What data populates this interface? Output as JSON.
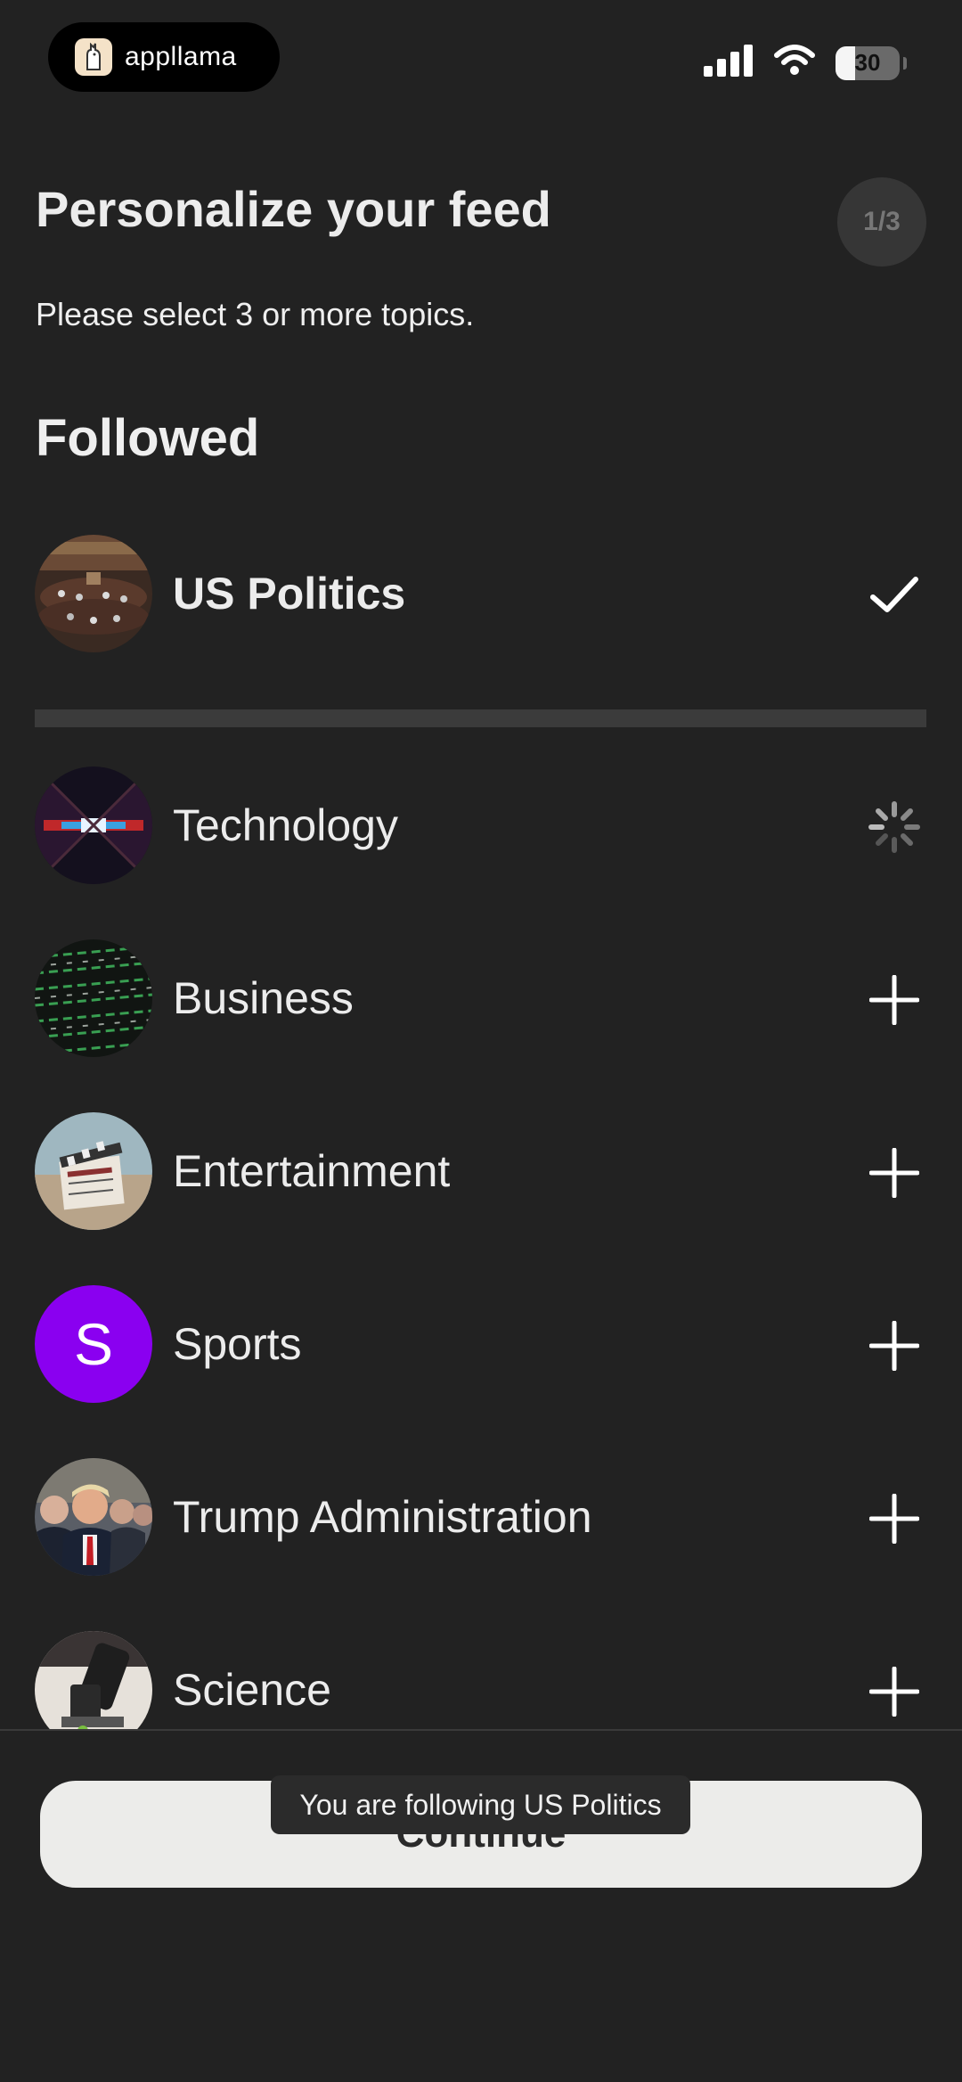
{
  "status_bar": {
    "app_name": "appllama",
    "battery": "30",
    "battery_level_percent": 30,
    "icons": [
      "cellular-signal-icon",
      "wifi-icon",
      "battery-icon"
    ]
  },
  "header": {
    "title": "Personalize your feed",
    "step": "1/3",
    "subtitle": "Please select 3 or more topics."
  },
  "followed": {
    "heading": "Followed",
    "items": [
      {
        "label": "US Politics",
        "state": "followed",
        "icon": "checkmark-icon"
      }
    ]
  },
  "topics": [
    {
      "label": "Technology",
      "state": "loading",
      "icon": "spinner-icon"
    },
    {
      "label": "Business",
      "state": "not-followed",
      "icon": "plus-icon"
    },
    {
      "label": "Entertainment",
      "state": "not-followed",
      "icon": "plus-icon"
    },
    {
      "label": "Sports",
      "avatar_letter": "S",
      "state": "not-followed",
      "icon": "plus-icon"
    },
    {
      "label": "Trump Administration",
      "state": "not-followed",
      "icon": "plus-icon"
    },
    {
      "label": "Science",
      "state": "not-followed",
      "icon": "plus-icon"
    }
  ],
  "continue_label": "Continue",
  "toast": "You are following US Politics",
  "colors": {
    "background": "#222222",
    "button": "#ececea",
    "sports_avatar": "#8a00f0"
  }
}
